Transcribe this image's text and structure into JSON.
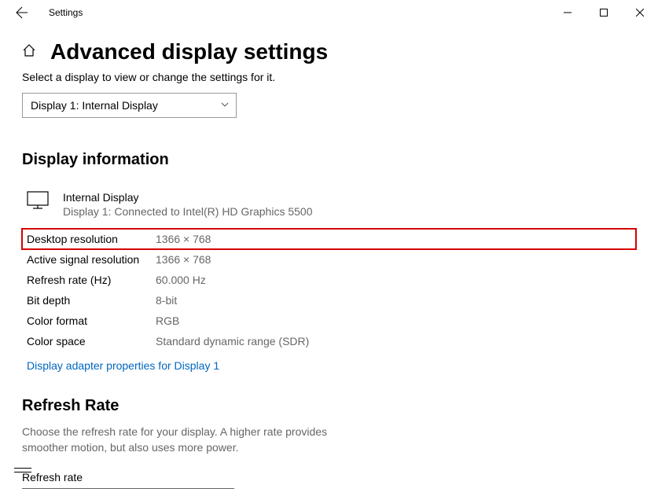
{
  "window": {
    "title": "Settings"
  },
  "page": {
    "heading": "Advanced display settings",
    "subtitle": "Select a display to view or change the settings for it."
  },
  "displaySelect": {
    "value": "Display 1: Internal Display"
  },
  "sections": {
    "info": {
      "title": "Display information",
      "displayName": "Internal Display",
      "displaySub": "Display 1: Connected to Intel(R) HD Graphics 5500",
      "rows": {
        "desktopResLabel": "Desktop resolution",
        "desktopResValue": "1366 × 768",
        "activeResLabel": "Active signal resolution",
        "activeResValue": "1366 × 768",
        "refreshLabel": "Refresh rate (Hz)",
        "refreshValue": "60.000 Hz",
        "bitDepthLabel": "Bit depth",
        "bitDepthValue": "8-bit",
        "colorFormatLabel": "Color format",
        "colorFormatValue": "RGB",
        "colorSpaceLabel": "Color space",
        "colorSpaceValue": "Standard dynamic range (SDR)"
      },
      "link": "Display adapter properties for Display 1"
    },
    "refresh": {
      "title": "Refresh Rate",
      "desc": "Choose the refresh rate for your display. A higher rate provides smoother motion, but also uses more power.",
      "fieldLabel": "Refresh rate"
    }
  }
}
